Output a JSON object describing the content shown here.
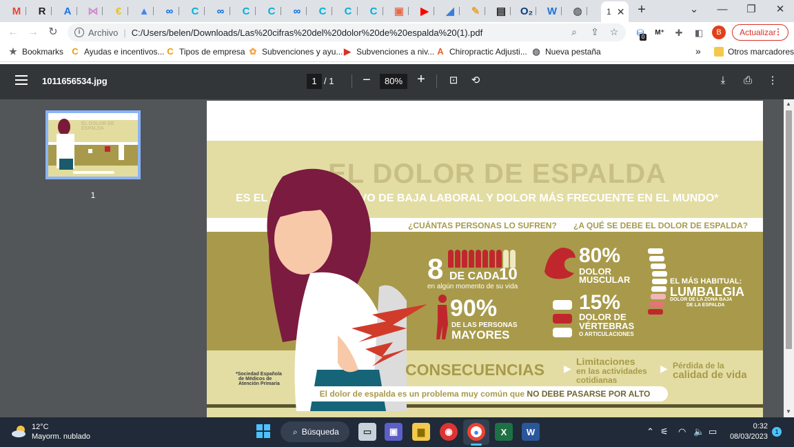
{
  "browser": {
    "tabs": [
      {
        "icon": "gmail-icon",
        "text": "M",
        "color": "#ea4335"
      },
      {
        "icon": "r-icon",
        "text": "R",
        "color": "#222"
      },
      {
        "icon": "a-icon",
        "text": "A",
        "color": "#1a73e8"
      },
      {
        "icon": "pattern-icon",
        "text": "⋈",
        "color": "#d08ad0"
      },
      {
        "icon": "coin-icon",
        "text": "€",
        "color": "#f2c200"
      },
      {
        "icon": "ads-icon",
        "text": "▲",
        "color": "#4285f4"
      },
      {
        "icon": "meta-icon",
        "text": "∞",
        "color": "#0668e1"
      },
      {
        "icon": "circle-c-icon",
        "text": "C",
        "color": "#00b2d6"
      },
      {
        "icon": "meta-icon",
        "text": "∞",
        "color": "#0668e1"
      },
      {
        "icon": "circle-c-icon",
        "text": "C",
        "color": "#00b2d6"
      },
      {
        "icon": "circle-c-icon",
        "text": "C",
        "color": "#00b2d6"
      },
      {
        "icon": "meta-icon",
        "text": "∞",
        "color": "#0668e1"
      },
      {
        "icon": "circle-c-icon",
        "text": "C",
        "color": "#00b2d6"
      },
      {
        "icon": "circle-c-icon",
        "text": "C",
        "color": "#00b2d6"
      },
      {
        "icon": "circle-c-icon",
        "text": "C",
        "color": "#00b2d6"
      },
      {
        "icon": "photo-icon",
        "text": "▣",
        "color": "#ea6b4a"
      },
      {
        "icon": "youtube-icon",
        "text": "▶",
        "color": "#ff0000"
      },
      {
        "icon": "cloud-icon",
        "text": "◢",
        "color": "#3b7dd8"
      },
      {
        "icon": "pen-icon",
        "text": "✎",
        "color": "#e8a33b"
      },
      {
        "icon": "doc-icon",
        "text": "▤",
        "color": "#222"
      },
      {
        "icon": "o2-icon",
        "text": "O₂",
        "color": "#0a3a7a"
      },
      {
        "icon": "w-icon",
        "text": "W",
        "color": "#1d74d8"
      },
      {
        "icon": "globe-icon",
        "text": "◍",
        "color": "#5f6368"
      }
    ],
    "active_tab_label": "1",
    "active_tab_close": "✕",
    "new_tab": "+",
    "url_proto": "Archivo",
    "url": "C:/Users/belen/Downloads/Las%20cifras%20del%20dolor%20de%20espalda%20(1).pdf",
    "avatar_letter": "B",
    "update_label": "Actualizar",
    "ext_badge": "0",
    "bookmarks": [
      {
        "label": "Bookmarks",
        "icon": "star-icon",
        "glyph": "★",
        "color": "#5f6368"
      },
      {
        "label": "Ayudas e incentivos...",
        "icon": "c-orange-icon",
        "glyph": "C",
        "color": "#f29900"
      },
      {
        "label": "Tipos de empresa",
        "icon": "c-orange-icon",
        "glyph": "C",
        "color": "#f29900"
      },
      {
        "label": "Subvenciones y ayu...",
        "icon": "flower-icon",
        "glyph": "✿",
        "color": "#f5a442"
      },
      {
        "label": "Subvenciones a niv...",
        "icon": "arrow-red-icon",
        "glyph": "▶",
        "color": "#d93025"
      },
      {
        "label": "Chiropractic Adjusti...",
        "icon": "a-orange-icon",
        "glyph": "A",
        "color": "#e8612c"
      },
      {
        "label": "Nueva pestaña",
        "icon": "globe-icon",
        "glyph": "◍",
        "color": "#5f6368"
      }
    ],
    "bookmarks_more": "»",
    "other_bookmarks": "Otros marcadores"
  },
  "pdf": {
    "filename": "1011656534.jpg",
    "page_current": "1",
    "page_total": "/ 1",
    "zoom": "80%",
    "thumb_label": "1"
  },
  "infographic": {
    "title": "EL DOLOR DE ESPALDA",
    "subtitle": "ES EL PRINCIPAL MOTIVO DE BAJA LABORAL Y DOLOR MÁS FRECUENTE EN EL MUNDO*",
    "q1": "¿CUÁNTAS PERSONAS LO SUFREN?",
    "q2": "¿A QUÉ SE DEBE EL DOLOR DE ESPALDA?",
    "stat1_big": "8",
    "stat1_of": "DE CADA",
    "stat1_ten": "10",
    "stat1_note": "en algún momento de su vida",
    "stat1_count_filled": 8,
    "stat1_count_total": 10,
    "stat2_pct": "90%",
    "stat2_line1": "DE LAS PERSONAS",
    "stat2_line2": "MAYORES",
    "stat3_pct": "80%",
    "stat3_line1": "DOLOR",
    "stat3_line2": "MUSCULAR",
    "stat4_pct": "15%",
    "stat4_line1": "DOLOR DE",
    "stat4_line2": "VÉRTEBRAS",
    "stat4_line3": "O ARTICULACIONES",
    "lumb_line1": "EL MÁS HABITUAL:",
    "lumb_line2": "LUMBALGIA",
    "lumb_line3": "DOLOR DE LA ZONA BAJA",
    "lumb_line4": "DE LA ESPALDA",
    "source_line1": "*Sociedad Española",
    "source_line2": "de Médicos de",
    "source_line3": "Atención Primaria",
    "conseq": "CONSECUENCIAS",
    "c1_line1": "Limitaciones",
    "c1_line2": "en las actividades",
    "c1_line3": "cotidianas",
    "c2_line1": "Pérdida de la",
    "c2_line2": "calidad de vida",
    "footer_pre": "El dolor de espalda es un problema muy común que ",
    "footer_bold": "NO DEBE PASARSE POR ALTO",
    "thumb_title": "EL DOLOR DE ESPALDA"
  },
  "taskbar": {
    "temp": "12°C",
    "condition": "Mayorm. nublado",
    "search": "Búsqueda",
    "time": "0:32",
    "date": "08/03/2023",
    "notif_count": "1"
  },
  "colors": {
    "olive": "#a89a4a",
    "cream": "#e3dda3",
    "red": "#c0272d",
    "white": "#ffffff"
  }
}
